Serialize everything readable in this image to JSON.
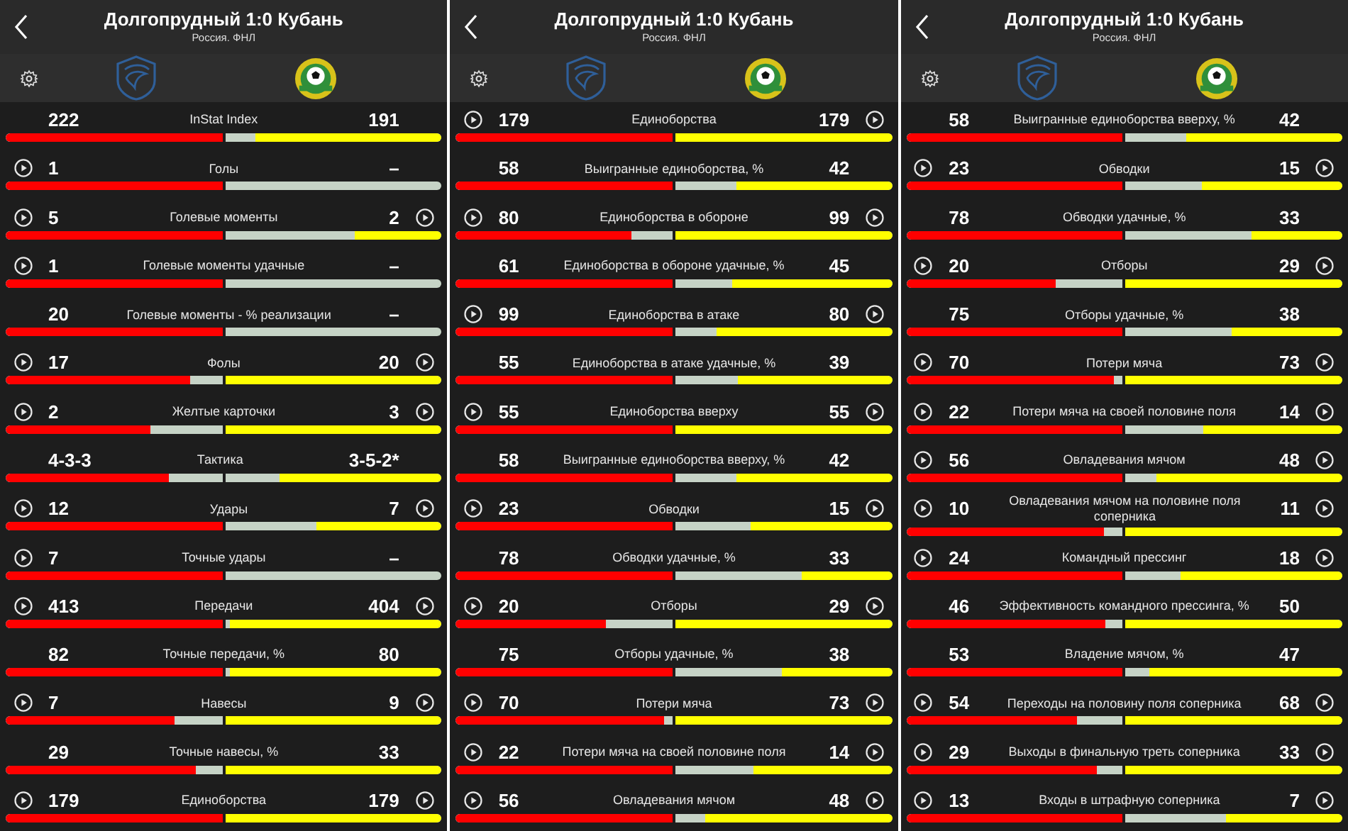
{
  "screens": [
    {
      "title": "Долгопрудный 1:0 Кубань",
      "subtitle": "Россия. ФНЛ",
      "stats": [
        {
          "label": "InStat Index",
          "home_value": "222",
          "away_value": "191",
          "home_video": false,
          "away_video": false,
          "home_bar": {
            "level": 1
          },
          "away_bar": {
            "level": 0.86
          }
        },
        {
          "label": "Голы",
          "home_value": "1",
          "away_value": "–",
          "home_video": true,
          "away_video": false,
          "home_bar": {
            "level": 1
          }
        },
        {
          "label": "Голевые моменты",
          "home_value": "5",
          "away_value": "2",
          "home_video": true,
          "away_video": true,
          "home_bar": {
            "level": 1
          },
          "away_bar": {
            "level": 0.4
          }
        },
        {
          "label": "Голевые моменты удачные",
          "home_value": "1",
          "away_value": "–",
          "home_video": true,
          "away_video": false,
          "home_bar": {
            "level": 1
          }
        },
        {
          "label": "Голевые моменты - % реализации",
          "home_value": "20",
          "away_value": "–",
          "home_video": false,
          "away_video": false,
          "home_bar": {
            "level": 1
          }
        },
        {
          "label": "Фолы",
          "home_value": "17",
          "away_value": "20",
          "home_video": true,
          "away_video": true,
          "home_bar": {
            "level": 0.85
          },
          "away_bar": {
            "level": 1
          }
        },
        {
          "label": "Желтые карточки",
          "home_value": "2",
          "away_value": "3",
          "home_video": true,
          "away_video": true,
          "home_bar": {
            "level": 0.67
          },
          "away_bar": {
            "level": 1
          }
        },
        {
          "label": "Тактика",
          "home_value": "4-3-3",
          "away_value": "3-5-2*",
          "home_video": false,
          "away_video": false,
          "home_bar": {
            "level": 0.75
          },
          "away_bar": {
            "level": 0.75
          }
        },
        {
          "label": "Удары",
          "home_value": "12",
          "away_value": "7",
          "home_video": true,
          "away_video": true,
          "home_bar": {
            "level": 1
          },
          "away_bar": {
            "level": 0.58
          }
        },
        {
          "label": "Точные удары",
          "home_value": "7",
          "away_value": "–",
          "home_video": true,
          "away_video": false,
          "home_bar": {
            "level": 1
          }
        },
        {
          "label": "Передачи",
          "home_value": "413",
          "away_value": "404",
          "home_video": true,
          "away_video": true,
          "home_bar": {
            "level": 1
          },
          "away_bar": {
            "level": 0.98
          }
        },
        {
          "label": "Точные передачи, %",
          "home_value": "82",
          "away_value": "80",
          "home_video": false,
          "away_video": false,
          "home_bar": {
            "level": 1
          },
          "away_bar": {
            "level": 0.98
          }
        },
        {
          "label": "Навесы",
          "home_value": "7",
          "away_value": "9",
          "home_video": true,
          "away_video": true,
          "home_bar": {
            "level": 0.78
          },
          "away_bar": {
            "level": 1
          }
        },
        {
          "label": "Точные навесы, %",
          "home_value": "29",
          "away_value": "33",
          "home_video": false,
          "away_video": false,
          "home_bar": {
            "level": 0.88
          },
          "away_bar": {
            "level": 1
          }
        },
        {
          "label": "Единоборства",
          "home_value": "179",
          "away_value": "179",
          "home_video": true,
          "away_video": true,
          "home_bar": {
            "level": 1
          },
          "away_bar": {
            "level": 1
          }
        }
      ]
    },
    {
      "title": "Долгопрудный 1:0 Кубань",
      "subtitle": "Россия. ФНЛ",
      "stats": [
        {
          "label": "Единоборства",
          "home_value": "179",
          "away_value": "179",
          "home_video": true,
          "away_video": true,
          "home_bar": {
            "level": 1
          },
          "away_bar": {
            "level": 1
          }
        },
        {
          "label": "Выигранные единоборства, %",
          "home_value": "58",
          "away_value": "42",
          "home_video": false,
          "away_video": false,
          "home_bar": {
            "level": 1
          },
          "away_bar": {
            "level": 0.72
          }
        },
        {
          "label": "Единоборства в обороне",
          "home_value": "80",
          "away_value": "99",
          "home_video": true,
          "away_video": true,
          "home_bar": {
            "level": 0.81
          },
          "away_bar": {
            "level": 1
          }
        },
        {
          "label": "Единоборства в обороне удачные, %",
          "home_value": "61",
          "away_value": "45",
          "home_video": false,
          "away_video": false,
          "home_bar": {
            "level": 1
          },
          "away_bar": {
            "level": 0.74
          }
        },
        {
          "label": "Единоборства в атаке",
          "home_value": "99",
          "away_value": "80",
          "home_video": true,
          "away_video": true,
          "home_bar": {
            "level": 1
          },
          "away_bar": {
            "level": 0.81
          }
        },
        {
          "label": "Единоборства в атаке удачные, %",
          "home_value": "55",
          "away_value": "39",
          "home_video": false,
          "away_video": false,
          "home_bar": {
            "level": 1
          },
          "away_bar": {
            "level": 0.71
          }
        },
        {
          "label": "Единоборства вверху",
          "home_value": "55",
          "away_value": "55",
          "home_video": true,
          "away_video": true,
          "home_bar": {
            "level": 1
          },
          "away_bar": {
            "level": 1
          }
        },
        {
          "label": "Выигранные единоборства вверху, %",
          "home_value": "58",
          "away_value": "42",
          "home_video": false,
          "away_video": false,
          "home_bar": {
            "level": 1
          },
          "away_bar": {
            "level": 0.72
          }
        },
        {
          "label": "Обводки",
          "home_value": "23",
          "away_value": "15",
          "home_video": true,
          "away_video": true,
          "home_bar": {
            "level": 1
          },
          "away_bar": {
            "level": 0.65
          }
        },
        {
          "label": "Обводки удачные, %",
          "home_value": "78",
          "away_value": "33",
          "home_video": false,
          "away_video": false,
          "home_bar": {
            "level": 1
          },
          "away_bar": {
            "level": 0.42
          }
        },
        {
          "label": "Отборы",
          "home_value": "20",
          "away_value": "29",
          "home_video": true,
          "away_video": true,
          "home_bar": {
            "level": 0.69
          },
          "away_bar": {
            "level": 1
          }
        },
        {
          "label": "Отборы удачные, %",
          "home_value": "75",
          "away_value": "38",
          "home_video": false,
          "away_video": false,
          "home_bar": {
            "level": 1
          },
          "away_bar": {
            "level": 0.51
          }
        },
        {
          "label": "Потери мяча",
          "home_value": "70",
          "away_value": "73",
          "home_video": true,
          "away_video": true,
          "home_bar": {
            "level": 0.96
          },
          "away_bar": {
            "level": 1
          }
        },
        {
          "label": "Потери мяча на своей половине поля",
          "home_value": "22",
          "away_value": "14",
          "home_video": true,
          "away_video": true,
          "home_bar": {
            "level": 1
          },
          "away_bar": {
            "level": 0.64
          }
        },
        {
          "label": "Овладевания мячом",
          "home_value": "56",
          "away_value": "48",
          "home_video": true,
          "away_video": true,
          "home_bar": {
            "level": 1
          },
          "away_bar": {
            "level": 0.86
          }
        }
      ]
    },
    {
      "title": "Долгопрудный 1:0 Кубань",
      "subtitle": "Россия. ФНЛ",
      "stats": [
        {
          "label": "Выигранные единоборства вверху, %",
          "home_value": "58",
          "away_value": "42",
          "home_video": false,
          "away_video": false,
          "home_bar": {
            "level": 1
          },
          "away_bar": {
            "level": 0.72
          }
        },
        {
          "label": "Обводки",
          "home_value": "23",
          "away_value": "15",
          "home_video": true,
          "away_video": true,
          "home_bar": {
            "level": 1
          },
          "away_bar": {
            "level": 0.65
          }
        },
        {
          "label": "Обводки удачные, %",
          "home_value": "78",
          "away_value": "33",
          "home_video": false,
          "away_video": false,
          "home_bar": {
            "level": 1
          },
          "away_bar": {
            "level": 0.42
          }
        },
        {
          "label": "Отборы",
          "home_value": "20",
          "away_value": "29",
          "home_video": true,
          "away_video": true,
          "home_bar": {
            "level": 0.69
          },
          "away_bar": {
            "level": 1
          }
        },
        {
          "label": "Отборы удачные, %",
          "home_value": "75",
          "away_value": "38",
          "home_video": false,
          "away_video": false,
          "home_bar": {
            "level": 1
          },
          "away_bar": {
            "level": 0.51
          }
        },
        {
          "label": "Потери мяча",
          "home_value": "70",
          "away_value": "73",
          "home_video": true,
          "away_video": true,
          "home_bar": {
            "level": 0.96
          },
          "away_bar": {
            "level": 1
          }
        },
        {
          "label": "Потери мяча на своей половине поля",
          "home_value": "22",
          "away_value": "14",
          "home_video": true,
          "away_video": true,
          "home_bar": {
            "level": 1
          },
          "away_bar": {
            "level": 0.64
          }
        },
        {
          "label": "Овладевания мячом",
          "home_value": "56",
          "away_value": "48",
          "home_video": true,
          "away_video": true,
          "home_bar": {
            "level": 1
          },
          "away_bar": {
            "level": 0.86
          }
        },
        {
          "label": "Овладевания мячом на половине поля соперника",
          "home_value": "10",
          "away_value": "11",
          "home_video": true,
          "away_video": true,
          "home_bar": {
            "level": 0.91
          },
          "away_bar": {
            "level": 1
          }
        },
        {
          "label": "Командный прессинг",
          "home_value": "24",
          "away_value": "18",
          "home_video": true,
          "away_video": true,
          "home_bar": {
            "level": 1
          },
          "away_bar": {
            "level": 0.75
          }
        },
        {
          "label": "Эффективность командного прессинга, %",
          "home_value": "46",
          "away_value": "50",
          "home_video": false,
          "away_video": false,
          "home_bar": {
            "level": 0.92
          },
          "away_bar": {
            "level": 1
          }
        },
        {
          "label": "Владение мячом, %",
          "home_value": "53",
          "away_value": "47",
          "home_video": false,
          "away_video": false,
          "home_bar": {
            "level": 1
          },
          "away_bar": {
            "level": 0.89
          }
        },
        {
          "label": "Переходы на половину поля соперника",
          "home_value": "54",
          "away_value": "68",
          "home_video": true,
          "away_video": true,
          "home_bar": {
            "level": 0.79
          },
          "away_bar": {
            "level": 1
          }
        },
        {
          "label": "Выходы в финальную треть соперника",
          "home_value": "29",
          "away_value": "33",
          "home_video": true,
          "away_video": true,
          "home_bar": {
            "level": 0.88
          },
          "away_bar": {
            "level": 1
          }
        },
        {
          "label": "Входы в штрафную соперника",
          "home_value": "13",
          "away_value": "7",
          "home_video": true,
          "away_video": true,
          "home_bar": {
            "level": 1
          },
          "away_bar": {
            "level": 0.54
          }
        }
      ]
    }
  ]
}
